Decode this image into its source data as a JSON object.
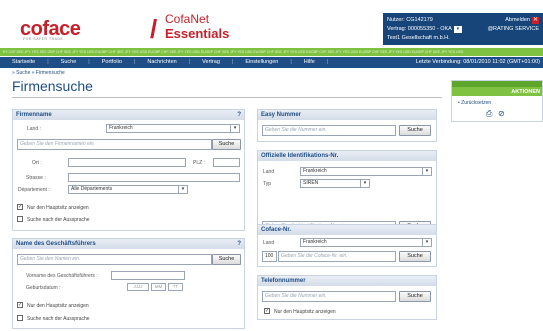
{
  "header": {
    "logo_main": "coface",
    "logo_tagline": "FOR SAFER TRADE",
    "product_line1": "CofaNet",
    "product_line2": "Essentials",
    "user_label": "Nutzer: CG142179",
    "logout_label": "Abmelden",
    "contract_label": "Vertrag: 000055350 - OKA",
    "rating_service_label": "@RATING SERVICE",
    "company_label": "Test1 Gesellschaft m.b.H.",
    "ticker_text": "EY CSF SEE JFY YES SEE GBP CHF SEE JFY YES USD EUGBP CHF SEE JFY YES USD EUGBP CHF SEE JFY YES USD EUGBP CHF SEE JFY YES USD EUGBP CHF SEE JFY YES USD EUGBP CHF SEE JFY YES USD EUGBP CHF SEE JFY YES USD EUGBP CHF SEE JFY YES USD"
  },
  "nav": {
    "items": [
      "Startseite",
      "Suche",
      "Portfolio",
      "Nachrichten",
      "Vertrag",
      "Einstellungen",
      "Hilfe"
    ],
    "last_connection": "Letzte Verbindung: 08/01/2010 11:02 (GMT+01:00)"
  },
  "breadcrumb": "» Suche » Firmensuche",
  "page_title": "Firmensuche",
  "firmenname": {
    "title": "Firmenname",
    "help": "?",
    "land_label": "Land :",
    "land_value": "Frankreich",
    "name_placeholder": "Geben Sie den Firmennamen ein.",
    "search_button": "Suche",
    "ort_label": "Ort :",
    "plz_label": "PLZ :",
    "strasse_label": "Strasse :",
    "departement_label": "Département :",
    "departement_value": "Alle Départements",
    "only_main_label": "Nur den Hauptsitz anzeigen",
    "phonetic_label": "Suche nach der Aussprache"
  },
  "geschaeftsfuehrer": {
    "title": "Name des Geschäftsführers",
    "help": "?",
    "name_placeholder": "Geben Sie den Namen ein.",
    "search_button": "Suche",
    "vorname_label": "Vorname des Geschäftsführers :",
    "geburt_label": "Geburtsdatum :",
    "date_jjjj": "JJJJ",
    "date_mm": "MM",
    "date_tt": "TT",
    "only_main_label": "Nur den Hauptsitz anzeigen",
    "phonetic_label": "Suche nach der Aussprache"
  },
  "easy": {
    "title": "Easy Nummer",
    "placeholder": "Geben Sie die Nummer ein.",
    "search_button": "Suche"
  },
  "official": {
    "title": "Offizielle Identifikations-Nr.",
    "land_label": "Land",
    "land_value": "Frankreich",
    "typ_label": "Typ",
    "typ_value": "SIREN",
    "placeholder": "Geben Sie die Identifikations-Nr. ein.",
    "search_button": "Suche"
  },
  "coface_nr": {
    "title": "Coface-Nr.",
    "land_label": "Land",
    "land_value": "Frankreich",
    "prefix": "100",
    "placeholder": "Geben Sie die Coface-Nr. ein.",
    "search_button": "Suche"
  },
  "telefon": {
    "title": "Telefonnummer",
    "placeholder": "Geben Sie die Nummer ein.",
    "search_button": "Suche",
    "only_main_label": "Nur den Hauptsitz anzeigen"
  },
  "aktionen": {
    "title": "AKTIONEN",
    "reset_label": "Zurücksetzen"
  }
}
